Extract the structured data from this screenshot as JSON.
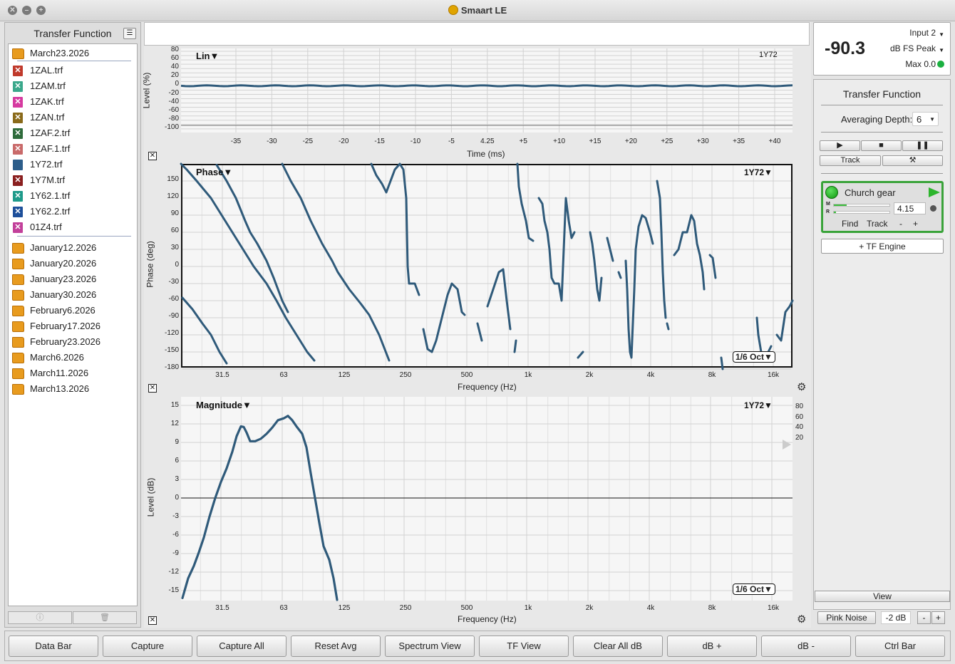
{
  "window": {
    "title": "Smaart LE"
  },
  "left": {
    "header": "Transfer Function",
    "open_folder": "March23.2026",
    "files": [
      {
        "name": "1ZAL.trf",
        "color": "#c0392b"
      },
      {
        "name": "1ZAM.trf",
        "color": "#3aa88b"
      },
      {
        "name": "1ZAK.trf",
        "color": "#d63aa0"
      },
      {
        "name": "1ZAN.trf",
        "color": "#8a6a1a"
      },
      {
        "name": "1ZAF.2.trf",
        "color": "#2e6b3b"
      },
      {
        "name": "1ZAF.1.trf",
        "color": "#c96a6a"
      },
      {
        "name": "1Y72.trf",
        "color": "#2c5d8a"
      },
      {
        "name": "1Y7M.trf",
        "color": "#8a1f1f"
      },
      {
        "name": "1Y62.1.trf",
        "color": "#1e9a8a"
      },
      {
        "name": "1Y62.2.trf",
        "color": "#1d4f9a"
      },
      {
        "name": "01Z4.trf",
        "color": "#c2409a"
      }
    ],
    "folders": [
      "January12.2026",
      "January20.2026",
      "January23.2026",
      "January30.2026",
      "February6.2026",
      "February17.2026",
      "February23.2026",
      "March6.2026",
      "March11.2026",
      "March13.2026"
    ]
  },
  "plots": {
    "impulse": {
      "name": "Lin",
      "trace": "1Y72",
      "ylabel": "Level (%)",
      "xlabel": "Time (ms)",
      "yticks": [
        "80",
        "60",
        "40",
        "20",
        "0",
        "-20",
        "-40",
        "-60",
        "-80",
        "-100"
      ],
      "xticks": [
        "-35",
        "-30",
        "-25",
        "-20",
        "-15",
        "-10",
        "-5",
        "4.25",
        "+5",
        "+10",
        "+15",
        "+20",
        "+25",
        "+30",
        "+35",
        "+40"
      ]
    },
    "phase": {
      "name": "Phase",
      "trace": "1Y72",
      "ylabel": "Phase (deg)",
      "xlabel": "Frequency (Hz)",
      "smoothing": "1/6 Oct",
      "yticks": [
        "150",
        "120",
        "90",
        "60",
        "30",
        "0",
        "-30",
        "-60",
        "-90",
        "-120",
        "-150",
        "-180"
      ],
      "xticks": [
        "31.5",
        "63",
        "125",
        "250",
        "500",
        "1k",
        "2k",
        "4k",
        "8k",
        "16k"
      ]
    },
    "magnitude": {
      "name": "Magnitude",
      "trace": "1Y72",
      "ylabel": "Level (dB)",
      "xlabel": "Frequency (Hz)",
      "smoothing": "1/6 Oct",
      "yticks": [
        "15",
        "12",
        "9",
        "6",
        "3",
        "0",
        "-3",
        "-6",
        "-9",
        "-12",
        "-15"
      ],
      "xticks": [
        "31.5",
        "63",
        "125",
        "250",
        "500",
        "1k",
        "2k",
        "4k",
        "8k",
        "16k"
      ],
      "coherence_ticks": [
        "80",
        "60",
        "40",
        "20"
      ]
    }
  },
  "meter": {
    "value": "-90.3",
    "input": "Input 2",
    "mode": "dB FS Peak",
    "max": "Max 0.0"
  },
  "tf_panel": {
    "title": "Transfer Function",
    "avg_label": "Averaging Depth:",
    "avg_value": "6",
    "track_label": "Track",
    "engine": {
      "name": "Church gear",
      "delay": "4.15",
      "find": "Find",
      "track": "Track",
      "minus": "-",
      "plus": "+"
    },
    "add_engine": "+ TF Engine",
    "view": "View",
    "pink_noise": "Pink Noise",
    "pink_level": "-2 dB",
    "minus": "-",
    "plus": "+"
  },
  "bottom_buttons": [
    "Data Bar",
    "Capture",
    "Capture All",
    "Reset Avg",
    "Spectrum View",
    "TF View",
    "Clear All dB",
    "dB +",
    "dB -",
    "Ctrl Bar"
  ],
  "colors": {
    "trace": "#2f5a7a",
    "accent_green": "#3aa33a",
    "folder": "#e89b1e"
  }
}
